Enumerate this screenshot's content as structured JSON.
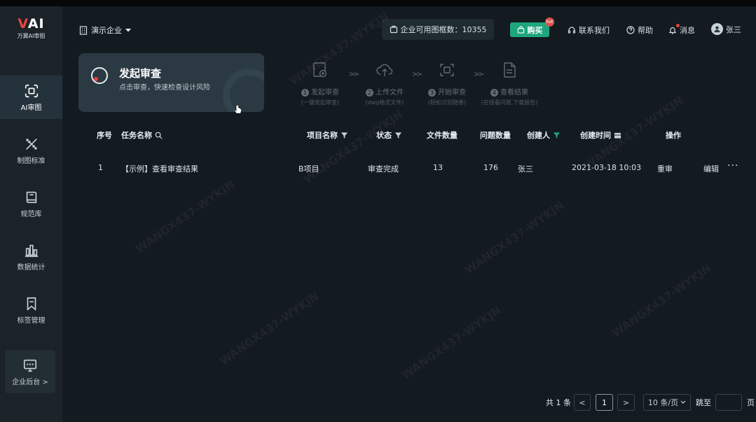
{
  "logo": {
    "mark_v": "V",
    "mark_ai": "AI",
    "subtitle": "万翼AI审图"
  },
  "sidebar": {
    "items": [
      {
        "label": "AI审图",
        "icon": "scan-frame-icon",
        "active": true
      },
      {
        "label": "制图标准",
        "icon": "ruler-pencil-icon",
        "active": false
      },
      {
        "label": "规范库",
        "icon": "book-icon",
        "active": false
      },
      {
        "label": "数据统计",
        "icon": "bar-chart-icon",
        "active": false
      },
      {
        "label": "标签管理",
        "icon": "bookmark-icon",
        "active": false
      }
    ],
    "bottom": {
      "label": "企业后台 >",
      "icon": "monitor-icon"
    }
  },
  "header": {
    "org_name": "演示企业",
    "quota": "企业可用图框数：10355",
    "buy_label": "购买",
    "buy_badge": "hot",
    "contact": "联系我们",
    "help": "帮助",
    "messages": "消息",
    "user": "张三"
  },
  "start_card": {
    "title": "发起审查",
    "subtitle": "点击审查，快速检查设计风险"
  },
  "steps": [
    {
      "num": "1",
      "title": "发起审查",
      "sub": "(一键发起审查)",
      "icon": "cloud-add-icon"
    },
    {
      "num": "2",
      "title": "上传文件",
      "sub": "(dwg格式文件)",
      "icon": "upload-cloud-icon"
    },
    {
      "num": "3",
      "title": "开始审查",
      "sub": "(轻松识别隐患)",
      "icon": "scan-frame-icon"
    },
    {
      "num": "4",
      "title": "查看结果",
      "sub": "(在线看问题,下载报告)",
      "icon": "document-icon"
    }
  ],
  "table": {
    "columns": {
      "index": "序号",
      "task": "任务名称",
      "project": "项目名称",
      "status": "状态",
      "files": "文件数量",
      "issues": "问题数量",
      "creator": "创建人",
      "created": "创建时间",
      "actions": "操作"
    },
    "rows": [
      {
        "index": "1",
        "task": "【示例】查看审查结果",
        "project": "B项目",
        "status": "审查完成",
        "files": "13",
        "issues": "176",
        "creator": "张三",
        "created": "2021-03-18 10:03",
        "action_recheck": "重审",
        "action_edit": "编辑",
        "action_more": "···"
      }
    ]
  },
  "pagination": {
    "total": "共 1 条",
    "prev": "<",
    "current": "1",
    "next": ">",
    "page_size": "10 条/页",
    "jump_label": "跳至",
    "jump_value": "",
    "page_unit": "页"
  },
  "watermark": "WANGX437-WYKJN",
  "colors": {
    "accent": "#1ea67c",
    "brand_red": "#e8443c",
    "bg": "#131a20",
    "sidebar": "#1b2329"
  }
}
